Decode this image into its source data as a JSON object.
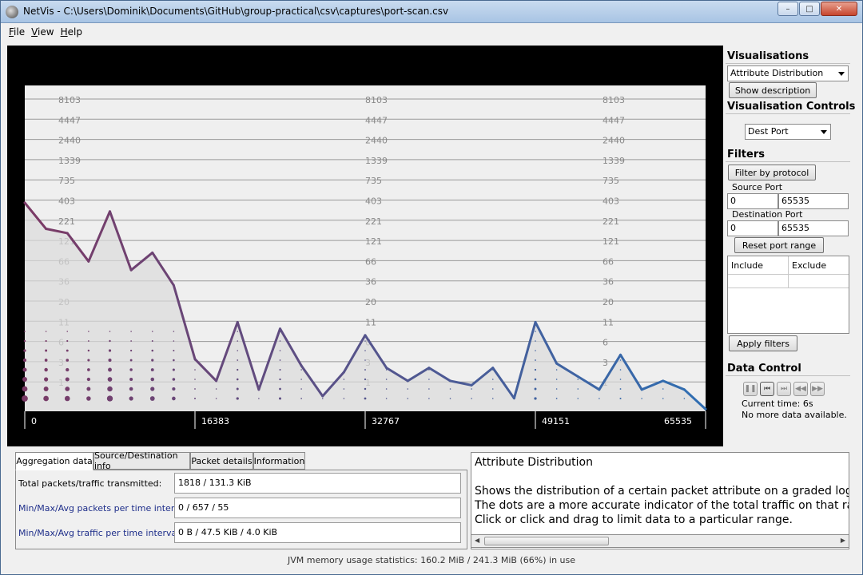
{
  "window": {
    "title": "NetVis - C:\\Users\\Dominik\\Documents\\GitHub\\group-practical\\csv\\captures\\port-scan.csv",
    "minimize": "–",
    "maximize": "□",
    "close": "✕"
  },
  "menu": [
    "File",
    "View",
    "Help"
  ],
  "chart_data": {
    "type": "line",
    "title": "",
    "xlabel": "",
    "ylabel": "",
    "x_ticks": [
      "0",
      "16383",
      "32767",
      "49151",
      "65535"
    ],
    "y_ticks_left": [
      "8103",
      "4447",
      "2440",
      "1339",
      "735",
      "403",
      "221",
      "121",
      "66",
      "36",
      "20",
      "11",
      "6",
      "3",
      "1"
    ],
    "y_ticks_mid": [
      "8103",
      "4447",
      "2440",
      "1339",
      "735",
      "403",
      "221",
      "121",
      "66",
      "36",
      "20",
      "11",
      "6",
      "3",
      "1"
    ],
    "y_ticks_right": [
      "8103",
      "4447",
      "2440",
      "1339",
      "735",
      "403",
      "221",
      "121",
      "66",
      "36",
      "20",
      "11",
      "6",
      "3",
      "1"
    ],
    "ylim_level": [
      0,
      15
    ],
    "series": [
      {
        "x": [
          0,
          2048,
          4096,
          6144,
          8192,
          10240,
          12288,
          14336,
          16384,
          18432,
          20480,
          22528,
          24576,
          26624,
          28672,
          30720,
          32768,
          34816,
          36864,
          38912,
          40960,
          43008,
          45056,
          47104,
          49152,
          51200,
          53248,
          55296,
          57344,
          59392,
          61440,
          63488,
          65535
        ],
        "level": [
          9.6,
          8.4,
          8.2,
          6.9,
          9.2,
          6.5,
          7.3,
          5.8,
          2.4,
          1.4,
          4.1,
          1.0,
          3.8,
          2.1,
          0.7,
          1.8,
          3.5,
          2.0,
          1.4,
          2.0,
          1.4,
          1.2,
          2.0,
          0.6,
          4.1,
          2.2,
          1.6,
          1.0,
          2.6,
          1.0,
          1.4,
          1.0,
          0.1
        ]
      }
    ],
    "dot_color_start": "#7a3a66",
    "dot_color_end": "#2e6fb3"
  },
  "panel": {
    "visualisations_title": "Visualisations",
    "visualisation_select": "Attribute Distribution",
    "show_description": "Show description",
    "controls_title": "Visualisation Controls",
    "attribute_select": "Dest Port",
    "filters_title": "Filters",
    "filter_protocol": "Filter by protocol",
    "source_port_label": "Source Port",
    "source_port_min": "0",
    "source_port_max": "65535",
    "dest_port_label": "Destination Port",
    "dest_port_min": "0",
    "dest_port_max": "65535",
    "reset_port_range": "Reset port range",
    "include_header": "Include",
    "exclude_header": "Exclude",
    "apply_filters": "Apply filters",
    "data_control_title": "Data Control",
    "current_time": "Current time: 6s",
    "no_more_data": "No more data available."
  },
  "tabs": [
    "Aggregation data",
    "Source/Destination info",
    "Packet details",
    "Information"
  ],
  "stats": [
    {
      "label": "Total packets/traffic transmitted:",
      "value": "1818 / 131.3 KiB"
    },
    {
      "label": "Min/Max/Avg packets per time interval:",
      "value": "0 / 657 / 55"
    },
    {
      "label": "Min/Max/Avg traffic per time interval:",
      "value": "0 B / 47.5 KiB / 4.0 KiB"
    }
  ],
  "description": {
    "title": "Attribute Distribution",
    "lines": [
      "Shows the distribution of a certain packet attribute on a graded log ch",
      "The dots are a more accurate indicator of the total traffic on that rang",
      "Click or click and drag to limit data to a particular range."
    ]
  },
  "status": "JVM memory usage statistics: 160.2 MiB / 241.3 MiB (66%) in use"
}
